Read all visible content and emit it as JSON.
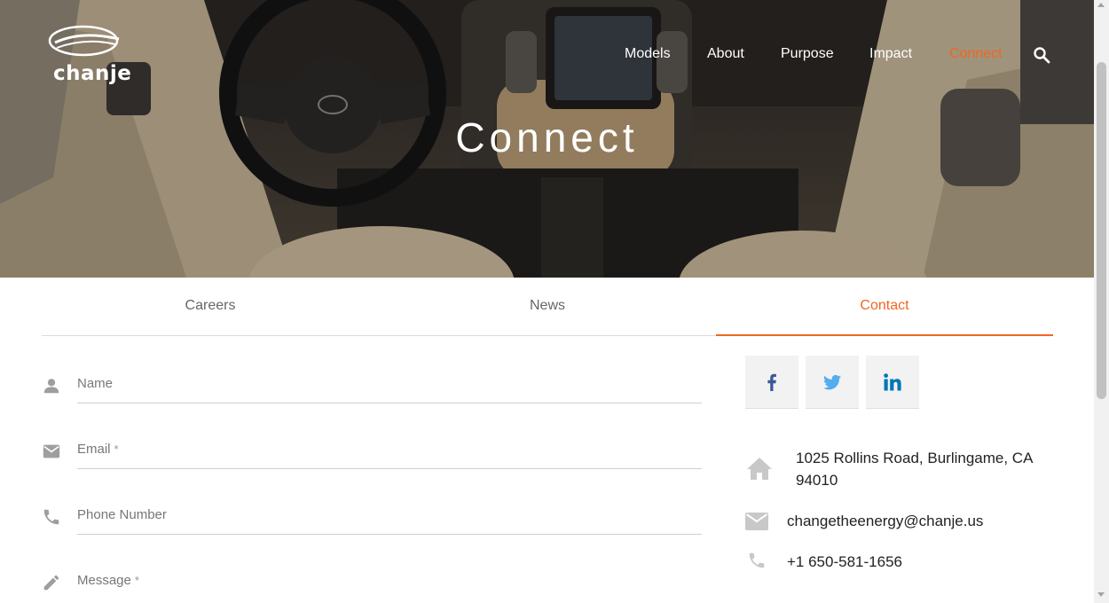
{
  "brand": {
    "logo_text": "chanje"
  },
  "nav": {
    "items": [
      {
        "label": "Models",
        "active": false
      },
      {
        "label": "About",
        "active": false
      },
      {
        "label": "Purpose",
        "active": false
      },
      {
        "label": "Impact",
        "active": false
      },
      {
        "label": "Connect",
        "active": true
      }
    ],
    "search_icon": "search-icon"
  },
  "hero": {
    "title": "Connect"
  },
  "tabs": [
    {
      "label": "Careers",
      "active": false
    },
    {
      "label": "News",
      "active": false
    },
    {
      "label": "Contact",
      "active": true
    }
  ],
  "form": {
    "fields": [
      {
        "label": "Name",
        "required": false,
        "icon": "person-icon"
      },
      {
        "label": "Email",
        "required": true,
        "icon": "mail-icon"
      },
      {
        "label": "Phone Number",
        "required": false,
        "icon": "phone-icon"
      },
      {
        "label": "Message",
        "required": true,
        "icon": "pencil-icon"
      }
    ],
    "required_mark": "*"
  },
  "social": [
    {
      "name": "facebook",
      "icon": "facebook-icon"
    },
    {
      "name": "twitter",
      "icon": "twitter-icon"
    },
    {
      "name": "linkedin",
      "icon": "linkedin-icon"
    }
  ],
  "contact": {
    "address_line1": "1025 Rollins Road, Burlingame, CA",
    "address_line2": "94010",
    "email": "changetheenergy@chanje.us",
    "phone": "+1 650-581-1656"
  },
  "colors": {
    "accent": "#f26522",
    "facebook": "#3b5998",
    "twitter": "#55acee",
    "linkedin": "#0077b5",
    "icon_gray": "#9e9e9e",
    "info_icon": "#c8c8c8"
  }
}
